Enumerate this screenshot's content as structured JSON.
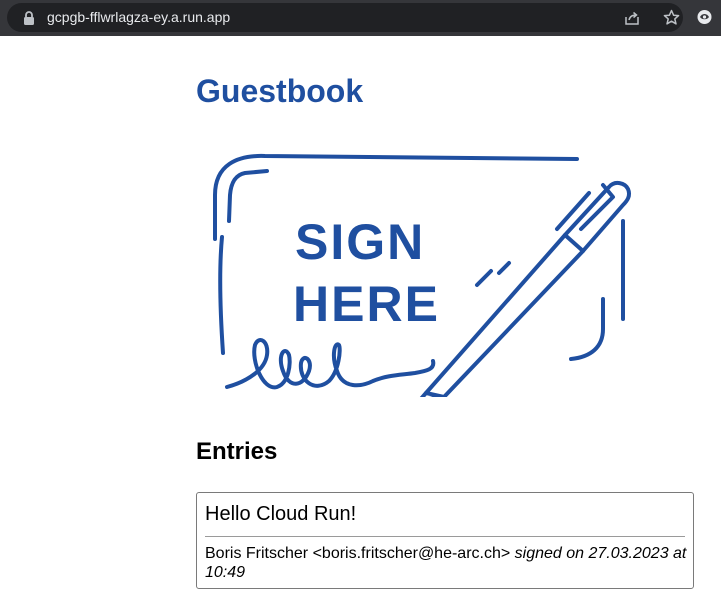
{
  "browser": {
    "url": "gcpgb-fflwrlagza-ey.a.run.app",
    "icons": [
      "lock-icon",
      "share-icon",
      "star-icon",
      "extension-icon"
    ]
  },
  "page": {
    "title": "Guestbook",
    "hero_image": {
      "text_line1": "SIGN",
      "text_line2": "HERE",
      "color": "#1f4fa0"
    },
    "entries_heading": "Entries",
    "entries": [
      {
        "message": "Hello Cloud Run!",
        "author": "Boris Fritscher <boris.fritscher@he-arc.ch>",
        "signed_text": "signed on 27.03.2023 at 10:49"
      }
    ]
  },
  "colors": {
    "brand_blue": "#1f4fa0",
    "browser_frame": "#35363a",
    "omnibox": "#202124",
    "url_text": "#e8eaed"
  }
}
